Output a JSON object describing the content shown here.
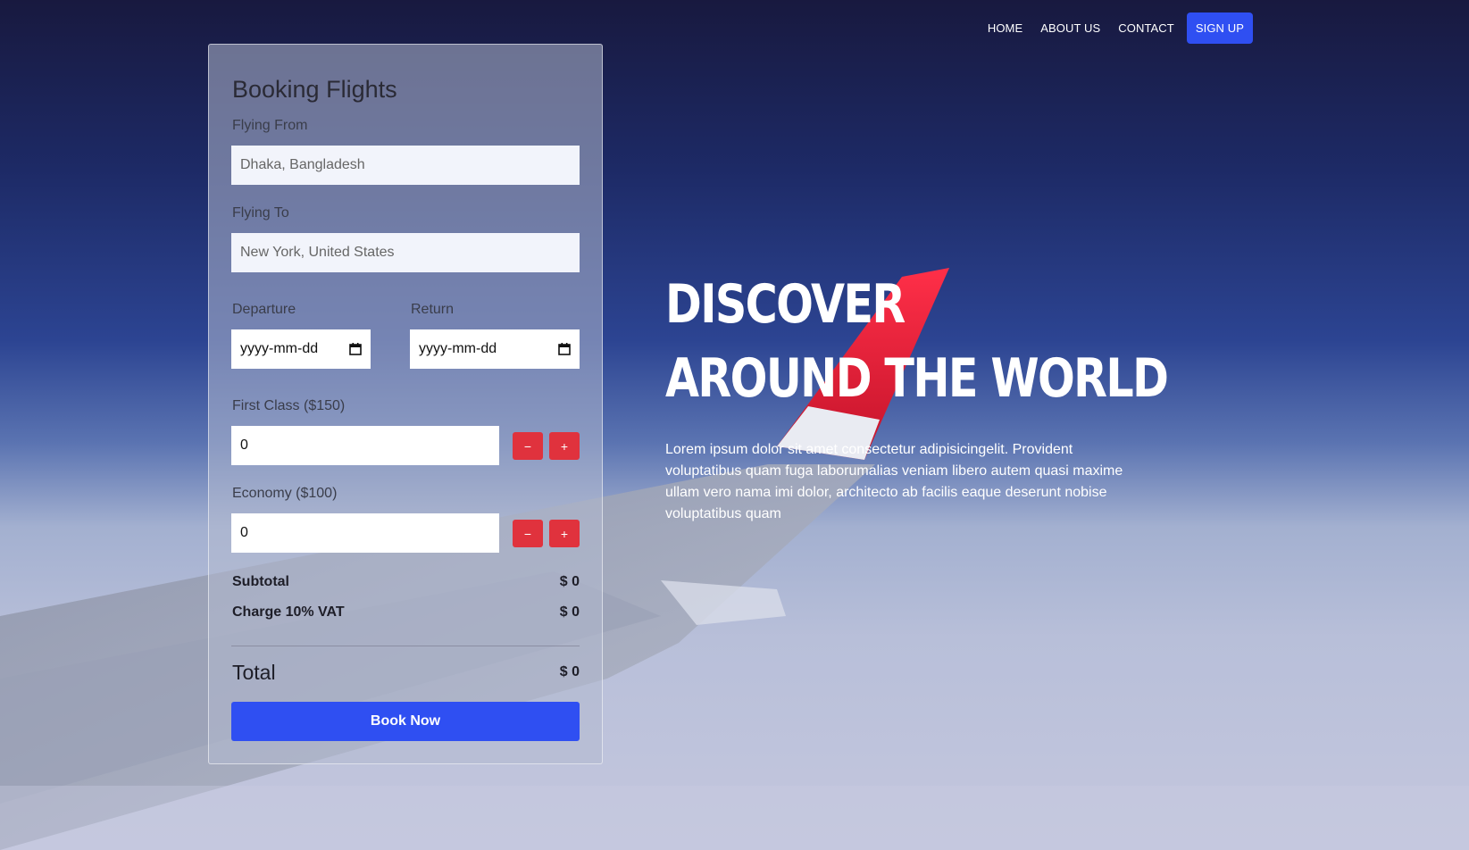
{
  "nav": {
    "items": [
      "HOME",
      "ABOUT US",
      "CONTACT"
    ],
    "signup_label": "SIGN UP"
  },
  "booking": {
    "title": "Booking Flights",
    "from_label": "Flying From",
    "from_placeholder": "Dhaka, Bangladesh",
    "to_label": "Flying To",
    "to_placeholder": "New York, United States",
    "departure_label": "Departure",
    "departure_value": "yyyy-mm-dd",
    "return_label": "Return",
    "return_value": "yyyy-mm-dd",
    "first_class_label": "First Class ($150)",
    "first_class_qty": "0",
    "economy_label": "Economy ($100)",
    "economy_qty": "0",
    "minus": "−",
    "plus": "+",
    "subtotal_label": "Subtotal",
    "subtotal_value": "$ 0",
    "vat_label": "Charge 10% VAT",
    "vat_value": "$ 0",
    "total_label": "Total",
    "total_value": "$ 0",
    "book_label": "Book Now"
  },
  "hero": {
    "title_line1": "DISCOVER",
    "title_line2": "AROUND THE WORLD",
    "text": "Lorem ipsum dolor sit amet consectetur adipisicingelit. Provident voluptatibus quam fuga laborumalias veniam libero autem quasi maxime ullam vero nama imi dolor, architecto ab facilis eaque deserunt nobise voluptatibus quam"
  },
  "colors": {
    "accent": "#2f4ff2",
    "danger": "#e0323d",
    "tail_red": "#e5213a"
  }
}
